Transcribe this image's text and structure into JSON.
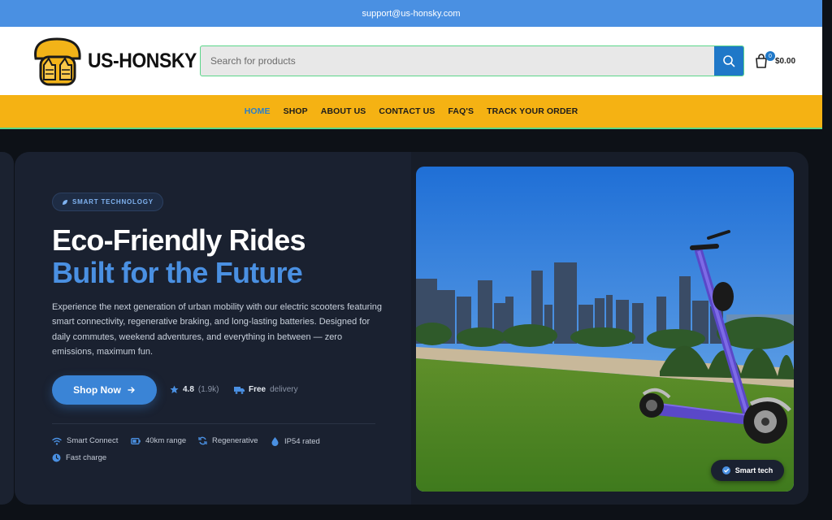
{
  "topbar": {
    "email": "support@us-honsky.com"
  },
  "header": {
    "logo_text": "US-HONSKY",
    "search_placeholder": "Search for products",
    "cart_count": "0",
    "cart_total": "$0.00"
  },
  "nav": {
    "items": [
      {
        "label": "HOME",
        "active": true
      },
      {
        "label": "SHOP"
      },
      {
        "label": "ABOUT US"
      },
      {
        "label": "CONTACT US"
      },
      {
        "label": "FAQ'S"
      },
      {
        "label": "TRACK YOUR ORDER"
      }
    ]
  },
  "hero": {
    "badge": "SMART TECHNOLOGY",
    "title_line1": "Eco-Friendly Rides",
    "title_line2": "Built for the Future",
    "description": "Experience the next generation of urban mobility with our electric scooters featuring smart connectivity, regenerative braking, and long-lasting batteries. Designed for daily commutes, weekend adventures, and everything in between — zero emissions, maximum fun.",
    "cta_label": "Shop Now",
    "rating_value": "4.8",
    "rating_count": "(1.9k)",
    "delivery_bold": "Free",
    "delivery_text": "delivery",
    "features": [
      "Smart Connect",
      "40km range",
      "Regenerative",
      "IP54 rated",
      "Fast charge"
    ],
    "image_tag": "Smart tech"
  },
  "colors": {
    "topbar": "#4a90e2",
    "nav": "#f5b213",
    "accent": "#3a84d6",
    "page_bg": "#0d1117"
  }
}
